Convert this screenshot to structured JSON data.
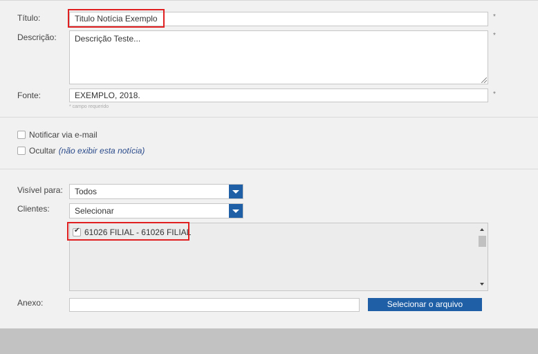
{
  "form": {
    "titulo": {
      "label": "Título:",
      "value": "Titulo Notícia Exemplo",
      "required": "*"
    },
    "descricao": {
      "label": "Descrição:",
      "value": "Descrição Teste...",
      "required": "*"
    },
    "fonte": {
      "label": "Fonte:",
      "value": "EXEMPLO, 2018.",
      "required": "*"
    },
    "hint": "* campo requerido"
  },
  "options": {
    "notificar": {
      "label": "Notificar via e-mail",
      "checked": false
    },
    "ocultar": {
      "label": "Ocultar",
      "note": "(não exibir esta notícia)",
      "checked": false
    }
  },
  "visibility": {
    "visivel_label": "Visível para:",
    "visivel_value": "Todos",
    "clientes_label": "Clientes:",
    "clientes_value": "Selecionar",
    "list": [
      {
        "label": "61026 FILIAL - 61026 FILIAL",
        "checked": true
      }
    ]
  },
  "anexo": {
    "label": "Anexo:",
    "value": "",
    "button": "Selecionar o arquivo"
  },
  "colors": {
    "accent": "#1f5fa6",
    "highlight": "#e02020",
    "background": "#f1f1f1",
    "footer": "#c2c2c2"
  }
}
